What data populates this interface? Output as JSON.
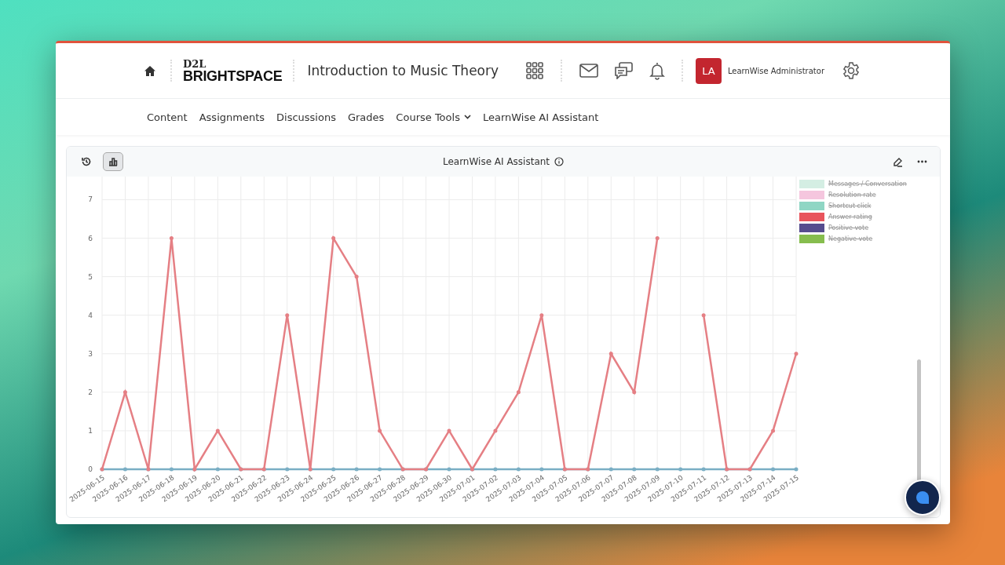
{
  "header": {
    "logo": {
      "top": "D2L",
      "bottom": "BRIGHTSPACE"
    },
    "course_title": "Introduction to Music Theory",
    "user": {
      "initials": "LA",
      "name": "LearnWise Administrator"
    }
  },
  "nav": [
    {
      "label": "Content",
      "has_menu": false
    },
    {
      "label": "Assignments",
      "has_menu": false
    },
    {
      "label": "Discussions",
      "has_menu": false
    },
    {
      "label": "Grades",
      "has_menu": false
    },
    {
      "label": "Course Tools",
      "has_menu": true
    },
    {
      "label": "LearnWise AI Assistant",
      "has_menu": false
    }
  ],
  "widget": {
    "title": "LearnWise AI Assistant",
    "view_buttons": [
      {
        "kind": "history",
        "selected": false
      },
      {
        "kind": "chart",
        "selected": true
      }
    ],
    "legend": [
      {
        "label": "Messages / Conversation",
        "color": "#d4eee3",
        "hidden": true
      },
      {
        "label": "Resolution rate",
        "color": "#f5c6de",
        "hidden": true
      },
      {
        "label": "Shortcut click",
        "color": "#8fd6c4",
        "hidden": true
      },
      {
        "label": "Answer rating",
        "color": "#e8545c",
        "hidden": true
      },
      {
        "label": "Positive vote",
        "color": "#564c8e",
        "hidden": true
      },
      {
        "label": "Negative vote",
        "color": "#86bd4e",
        "hidden": true
      }
    ],
    "chart_data": {
      "type": "line",
      "categories": [
        "2025-06-15",
        "2025-06-16",
        "2025-06-17",
        "2025-06-18",
        "2025-06-19",
        "2025-06-20",
        "2025-06-21",
        "2025-06-22",
        "2025-06-23",
        "2025-06-24",
        "2025-06-25",
        "2025-06-26",
        "2025-06-27",
        "2025-06-28",
        "2025-06-29",
        "2025-06-30",
        "2025-07-01",
        "2025-07-02",
        "2025-07-03",
        "2025-07-04",
        "2025-07-05",
        "2025-07-06",
        "2025-07-07",
        "2025-07-08",
        "2025-07-09",
        "2025-07-10",
        "2025-07-11",
        "2025-07-12",
        "2025-07-13",
        "2025-07-14",
        "2025-07-15"
      ],
      "series": [
        {
          "color": "#e57f84",
          "values": [
            0,
            2,
            0,
            6,
            0,
            1,
            0,
            0,
            4,
            0,
            6,
            5,
            1,
            0,
            0,
            1,
            0,
            1,
            2,
            4,
            0,
            0,
            3,
            2,
            6,
            null,
            4,
            0,
            0,
            1,
            3
          ]
        },
        {
          "color": "#7aaec4",
          "values": [
            0,
            0,
            0,
            0,
            0,
            0,
            0,
            0,
            0,
            0,
            0,
            0,
            0,
            0,
            0,
            0,
            0,
            0,
            0,
            0,
            0,
            0,
            0,
            0,
            0,
            0,
            0,
            0,
            0,
            0,
            0
          ]
        }
      ],
      "ylim": [
        0,
        7.6
      ],
      "grid": true,
      "yticks": [
        0,
        1,
        2,
        3,
        4,
        5,
        6,
        7
      ]
    }
  }
}
